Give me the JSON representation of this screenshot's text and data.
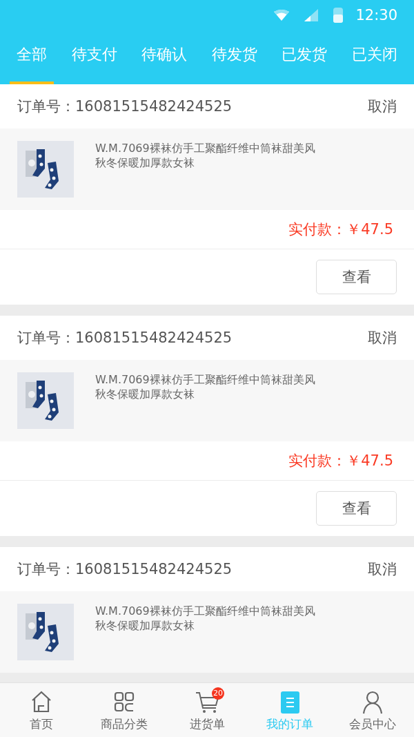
{
  "status_bar": {
    "time": "12:30"
  },
  "tabs": [
    {
      "label": "全部",
      "selected": true
    },
    {
      "label": "待支付",
      "selected": false
    },
    {
      "label": "待确认",
      "selected": false
    },
    {
      "label": "待发货",
      "selected": false
    },
    {
      "label": "已发货",
      "selected": false
    },
    {
      "label": "已关闭",
      "selected": false
    }
  ],
  "orders": [
    {
      "order_number": "订单号：16081515482424525",
      "action": "取消",
      "product": {
        "kind": "picture",
        "title": "W.M.7069裸袜仿手工聚酯纤维中筒袜甜美风秋冬保暖加厚款女袜"
      },
      "paid": "实付款：￥47.5",
      "button": "查看"
    },
    {
      "order_number": "订单号：16081515482424525",
      "action": "取消",
      "product": {
        "kind": "picture",
        "title": "W.M.7069裸袜仿手工聚酯纤维中筒袜甜美风秋冬保暖加厚款女袜"
      },
      "paid": "实付款：￥47.5",
      "button": "查看"
    },
    {
      "order_number": "订单号：16081515482424525",
      "action": "取消",
      "product": {
        "kind": "picture",
        "title": "W.M.7069裸袜仿手工聚酯纤维中筒袜甜美风秋冬保暖加厚款女袜"
      }
    }
  ],
  "bottom_nav": [
    {
      "kind": "home",
      "label": "首页",
      "selected": false
    },
    {
      "kind": "grid",
      "label": "商品分类",
      "selected": false
    },
    {
      "kind": "cart",
      "label": "进货单",
      "selected": false,
      "badge": "20"
    },
    {
      "kind": "orders",
      "label": "我的订单",
      "selected": true
    },
    {
      "kind": "user",
      "label": "会员中心",
      "selected": false
    }
  ]
}
